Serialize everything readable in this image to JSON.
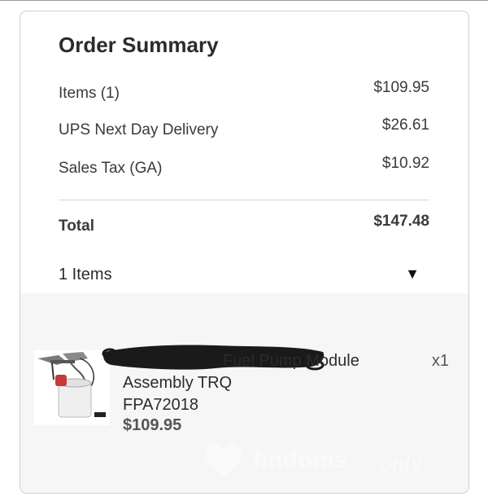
{
  "summary": {
    "title": "Order Summary",
    "rows": [
      {
        "label": "Items (1)",
        "amount": "$109.95"
      },
      {
        "label": "UPS Next Day Delivery",
        "amount": "$26.61"
      },
      {
        "label": "Sales Tax (GA)",
        "amount": "$10.92"
      }
    ],
    "total": {
      "label": "Total",
      "amount": "$147.48"
    }
  },
  "items_toggle": {
    "label": "1 Items",
    "caret": "▼"
  },
  "cart": {
    "items": [
      {
        "name": "Fuel Pump Module Assembly TRQ",
        "sku": "FPA72018",
        "price": "$109.95",
        "quantity": "x1"
      }
    ]
  },
  "watermark": {
    "brand": "findoms",
    "suffix": "only"
  },
  "colors": {
    "panel_bg": "#f6f6f6",
    "text": "#2b2b2b",
    "muted": "#555555",
    "divider": "#d6d6d6"
  }
}
